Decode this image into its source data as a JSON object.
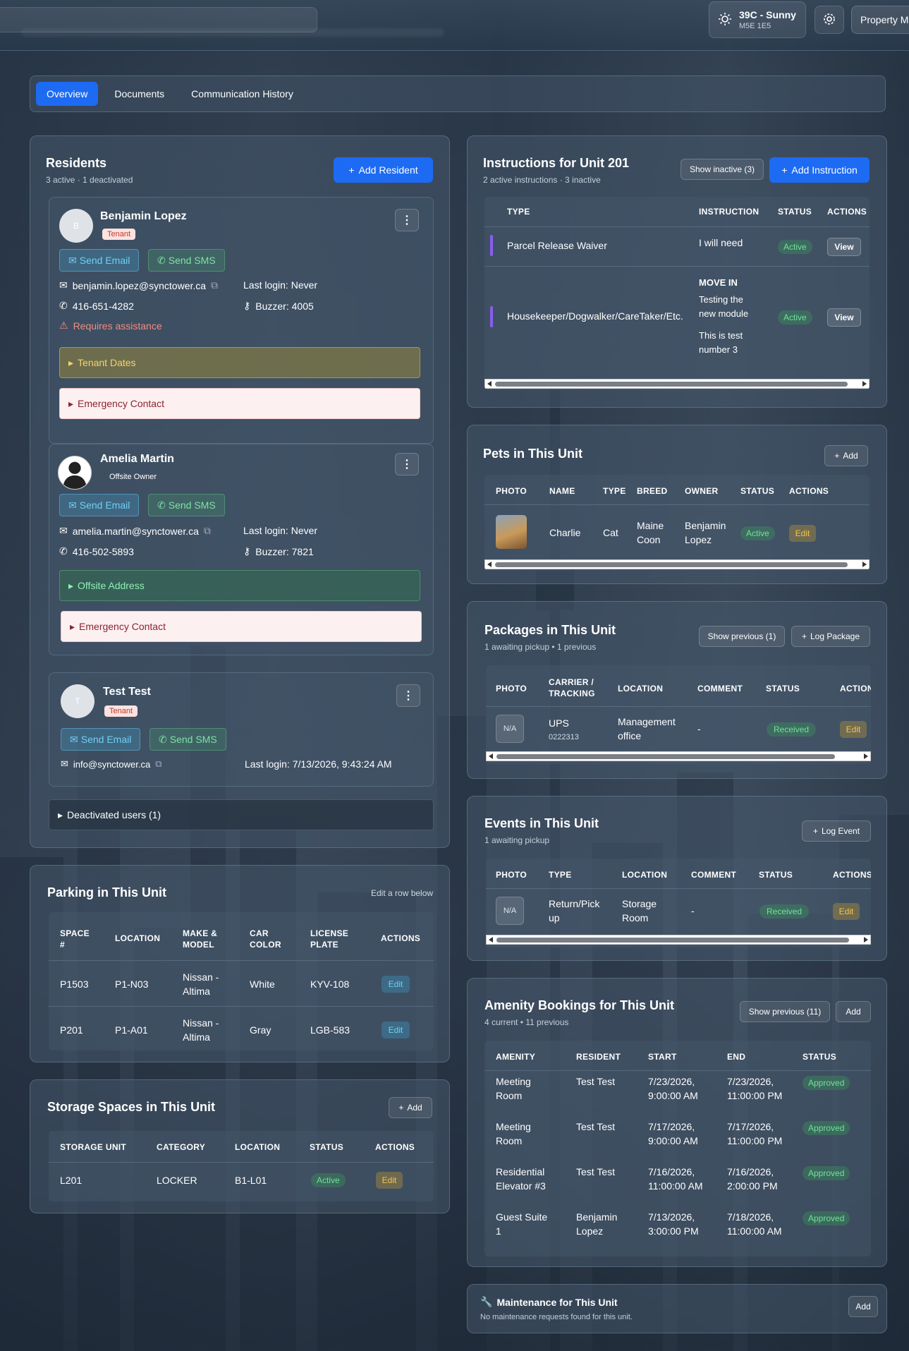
{
  "topbar": {
    "weather_temp": "39C - Sunny",
    "weather_postal": "M5E 1E5",
    "property_label": "Property M"
  },
  "tabs": [
    {
      "label": "Overview",
      "active": true
    },
    {
      "label": "Documents",
      "active": false
    },
    {
      "label": "Communication History",
      "active": false
    }
  ],
  "residents": {
    "title": "Residents",
    "subtitle": "3 active · 1 deactivated",
    "add_label": "Add Resident",
    "list": [
      {
        "initial": "B",
        "name": "Benjamin Lopez",
        "role": "Tenant",
        "email": "benjamin.lopez@synctower.ca",
        "phone": "416-651-4282",
        "last_login": "Last login: Never",
        "buzzer": "Buzzer: 4005",
        "assist": "Requires assistance",
        "dates": "Tenant Dates",
        "emergency": "Emergency Contact"
      },
      {
        "name": "Amelia Martin",
        "role": "Offsite Owner",
        "email": "amelia.martin@synctower.ca",
        "phone": "416-502-5893",
        "last_login": "Last login: Never",
        "buzzer": "Buzzer: 7821",
        "address": "Offsite Address",
        "emergency": "Emergency Contact"
      },
      {
        "initial": "T",
        "name": "Test Test",
        "role": "Tenant",
        "email": "info@synctower.ca",
        "last_login": "Last login: 7/13/2026, 9:43:24 AM"
      }
    ],
    "send_email": "Send Email",
    "send_sms": "Send SMS",
    "deactivated": "Deactivated users (1)"
  },
  "instructions": {
    "title": "Instructions for Unit 201",
    "subtitle": "2 active instructions · 3 inactive",
    "show_inactive": "Show inactive (3)",
    "add_label": "Add Instruction",
    "headers": [
      "TYPE",
      "INSTRUCTION",
      "STATUS",
      "ACTIONS"
    ],
    "rows": [
      {
        "type": "Parcel Release Waiver",
        "instruction": "I will need",
        "status": "Active",
        "action": "View"
      },
      {
        "type": "Housekeeper/Dogwalker/CareTaker/Etc.",
        "instruction_title": "MOVE IN",
        "instruction_l1": "Testing the",
        "instruction_l2": "new module",
        "instruction_l3": "This is test",
        "instruction_l4": "number 3",
        "status": "Active",
        "action": "View"
      }
    ]
  },
  "pets": {
    "title": "Pets in This Unit",
    "add_label": "Add",
    "headers": [
      "PHOTO",
      "NAME",
      "TYPE",
      "BREED",
      "OWNER",
      "STATUS",
      "ACTIONS"
    ],
    "rows": [
      {
        "name": "Charlie",
        "type": "Cat",
        "breed_l1": "Maine",
        "breed_l2": "Coon",
        "owner_l1": "Benjamin",
        "owner_l2": "Lopez",
        "status": "Active",
        "action": "Edit"
      }
    ]
  },
  "packages": {
    "title": "Packages in This Unit",
    "subtitle": "1 awaiting pickup • 1 previous",
    "show_previous": "Show previous (1)",
    "log_label": "Log Package",
    "headers": [
      "PHOTO",
      "CARRIER /",
      "TRACKING",
      "LOCATION",
      "COMMENT",
      "STATUS",
      "ACTION"
    ],
    "rows": [
      {
        "photo": "N/A",
        "carrier": "UPS",
        "tracking": "0222313",
        "location_l1": "Management",
        "location_l2": "office",
        "comment": "-",
        "status": "Received",
        "action": "Edit"
      }
    ]
  },
  "events": {
    "title": "Events in This Unit",
    "subtitle": "1 awaiting pickup",
    "log_label": "Log Event",
    "headers": [
      "PHOTO",
      "TYPE",
      "LOCATION",
      "COMMENT",
      "STATUS",
      "ACTIONS"
    ],
    "rows": [
      {
        "photo": "N/A",
        "type_l1": "Return/Pick",
        "type_l2": "up",
        "location_l1": "Storage",
        "location_l2": "Room",
        "comment": "-",
        "status": "Received",
        "action": "Edit"
      }
    ]
  },
  "parking": {
    "title": "Parking in This Unit",
    "hint": "Edit a row below",
    "headers": [
      "SPACE",
      "#",
      "LOCATION",
      "MAKE &",
      "MODEL",
      "CAR",
      "COLOR",
      "LICENSE",
      "PLATE",
      "ACTIONS"
    ],
    "rows": [
      {
        "space": "P1503",
        "location": "P1-N03",
        "make_l1": "Nissan -",
        "make_l2": "Altima",
        "color": "White",
        "plate": "KYV-108",
        "action": "Edit"
      },
      {
        "space": "P201",
        "location": "P1-A01",
        "make_l1": "Nissan -",
        "make_l2": "Altima",
        "color": "Gray",
        "plate": "LGB-583",
        "action": "Edit"
      }
    ]
  },
  "storage": {
    "title": "Storage Spaces in This Unit",
    "add_label": "Add",
    "headers": [
      "STORAGE UNIT",
      "CATEGORY",
      "LOCATION",
      "STATUS",
      "ACTIONS"
    ],
    "rows": [
      {
        "unit": "L201",
        "category": "LOCKER",
        "location": "B1-L01",
        "status": "Active",
        "action": "Edit"
      }
    ]
  },
  "amenity": {
    "title": "Amenity Bookings for This Unit",
    "subtitle": "4 current • 11 previous",
    "show_previous": "Show previous (11)",
    "add_label": "Add",
    "headers": [
      "AMENITY",
      "RESIDENT",
      "START",
      "END",
      "STATUS"
    ],
    "rows": [
      {
        "a1": "Meeting",
        "a2": "Room",
        "r1": "Test Test",
        "r2": "",
        "s1": "7/23/2026,",
        "s2": "9:00:00 AM",
        "e1": "7/23/2026,",
        "e2": "11:00:00 PM",
        "status": "Approved"
      },
      {
        "a1": "Meeting",
        "a2": "Room",
        "r1": "Test Test",
        "r2": "",
        "s1": "7/17/2026,",
        "s2": "9:00:00 AM",
        "e1": "7/17/2026,",
        "e2": "11:00:00 PM",
        "status": "Approved"
      },
      {
        "a1": "Residential",
        "a2": "Elevator #3",
        "r1": "Test Test",
        "r2": "",
        "s1": "7/16/2026,",
        "s2": "11:00:00 AM",
        "e1": "7/16/2026,",
        "e2": "2:00:00 PM",
        "status": "Approved"
      },
      {
        "a1": "Guest Suite",
        "a2": "1",
        "r1": "Benjamin",
        "r2": "Lopez",
        "s1": "7/13/2026,",
        "s2": "3:00:00 PM",
        "e1": "7/18/2026,",
        "e2": "11:00:00 AM",
        "status": "Approved"
      }
    ]
  },
  "maintenance": {
    "title": "Maintenance for This Unit",
    "subtitle": "No maintenance requests found for this unit.",
    "add_label": "Add"
  }
}
